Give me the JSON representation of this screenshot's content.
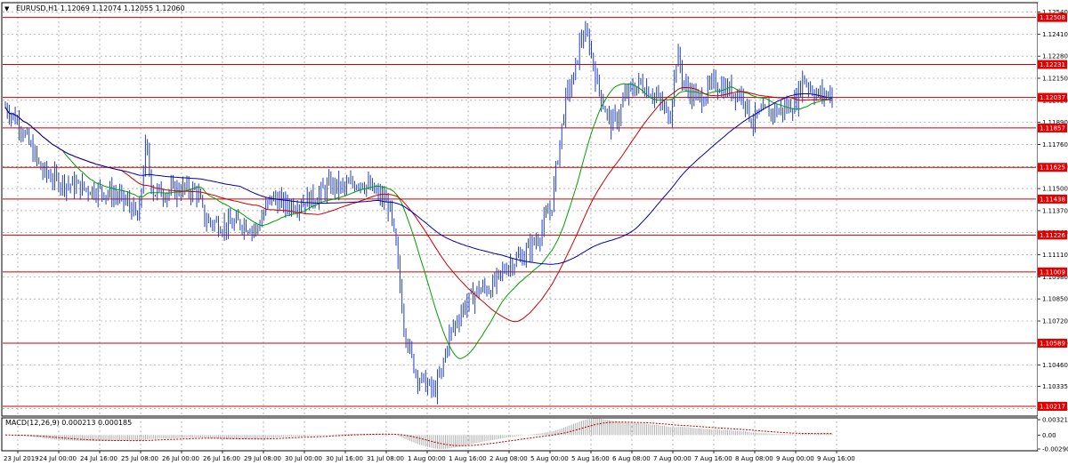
{
  "chart_data": {
    "type": "candlestick",
    "symbol_header": "EURUSD,H1  1.12069 1.12074 1.12055 1.12060",
    "y_ticks": [
      "1.12540",
      "1.12410",
      "1.12280",
      "1.12150",
      "1.12020",
      "1.11890",
      "1.11760",
      "1.11630",
      "1.11500",
      "1.11370",
      "1.11240",
      "1.11110",
      "1.10980",
      "1.10850",
      "1.10720",
      "1.10590",
      "1.10460",
      "1.10335",
      "1.10205"
    ],
    "x_ticks": [
      "23 Jul 2019",
      "24 Jul 00:00",
      "24 Jul 16:00",
      "25 Jul 08:00",
      "26 Jul 00:00",
      "26 Jul 16:00",
      "29 Jul 08:00",
      "30 Jul 00:00",
      "30 Jul 16:00",
      "31 Jul 08:00",
      "1 Aug 00:00",
      "1 Aug 16:00",
      "2 Aug 08:00",
      "5 Aug 00:00",
      "5 Aug 16:00",
      "6 Aug 08:00",
      "7 Aug 00:00",
      "7 Aug 16:00",
      "8 Aug 08:00",
      "9 Aug 00:00",
      "9 Aug 16:00"
    ],
    "ylim": [
      1.1017,
      1.1259
    ],
    "grid": true,
    "levels": [
      {
        "label": "1.12508",
        "value": 1.12508
      },
      {
        "label": "1.12231",
        "value": 1.12231
      },
      {
        "label": "1.11857",
        "value": 1.11857
      },
      {
        "label": "1.11625",
        "value": 1.11625
      },
      {
        "label": "1.11438",
        "value": 1.11438
      },
      {
        "label": "1.11226",
        "value": 1.11226
      },
      {
        "label": "1.11009",
        "value": 1.11009
      },
      {
        "label": "1.10589",
        "value": 1.10589
      },
      {
        "label": "1.10217",
        "value": 1.10217
      }
    ],
    "current_price": {
      "label": "1.12037",
      "value": 1.12037
    },
    "price_path": [
      [
        0,
        1.1198
      ],
      [
        2,
        1.1188
      ],
      [
        3,
        1.1178
      ],
      [
        5,
        1.116
      ],
      [
        7,
        1.1155
      ],
      [
        9,
        1.1152
      ],
      [
        11,
        1.115
      ],
      [
        13,
        1.1149
      ],
      [
        15,
        1.1146
      ],
      [
        17,
        1.114
      ],
      [
        18,
        1.113
      ],
      [
        19,
        1.1175
      ],
      [
        20,
        1.1148
      ],
      [
        22,
        1.1148
      ],
      [
        24,
        1.115
      ],
      [
        26,
        1.1148
      ],
      [
        27,
        1.1132
      ],
      [
        28,
        1.113
      ],
      [
        30,
        1.1128
      ],
      [
        32,
        1.113
      ],
      [
        34,
        1.1126
      ],
      [
        35,
        1.1135
      ],
      [
        36,
        1.1145
      ],
      [
        38,
        1.114
      ],
      [
        40,
        1.1142
      ],
      [
        42,
        1.1145
      ],
      [
        44,
        1.1152
      ],
      [
        46,
        1.115
      ],
      [
        48,
        1.1155
      ],
      [
        50,
        1.1148
      ],
      [
        52,
        1.114
      ],
      [
        53,
        1.1112
      ],
      [
        54,
        1.107
      ],
      [
        55,
        1.105
      ],
      [
        56,
        1.1038
      ],
      [
        57,
        1.1035
      ],
      [
        58,
        1.103
      ],
      [
        59,
        1.104
      ],
      [
        60,
        1.1062
      ],
      [
        62,
        1.108
      ],
      [
        64,
        1.109
      ],
      [
        66,
        1.1092
      ],
      [
        68,
        1.1105
      ],
      [
        70,
        1.111
      ],
      [
        72,
        1.112
      ],
      [
        74,
        1.114
      ],
      [
        75,
        1.1175
      ],
      [
        76,
        1.1205
      ],
      [
        77,
        1.1215
      ],
      [
        78,
        1.124
      ],
      [
        79,
        1.1238
      ],
      [
        80,
        1.1215
      ],
      [
        81,
        1.12
      ],
      [
        82,
        1.1188
      ],
      [
        83,
        1.1192
      ],
      [
        84,
        1.1205
      ],
      [
        86,
        1.1212
      ],
      [
        88,
        1.1205
      ],
      [
        90,
        1.1192
      ],
      [
        91,
        1.123
      ],
      [
        92,
        1.121
      ],
      [
        94,
        1.1202
      ],
      [
        96,
        1.1212
      ],
      [
        98,
        1.1208
      ],
      [
        100,
        1.1205
      ],
      [
        101,
        1.119
      ],
      [
        103,
        1.1195
      ],
      [
        105,
        1.1196
      ],
      [
        107,
        1.12
      ],
      [
        108,
        1.1215
      ],
      [
        110,
        1.1205
      ],
      [
        112,
        1.1206
      ]
    ],
    "moving_averages": [
      {
        "color": "#00a000",
        "period": 10
      },
      {
        "color": "#cc0000",
        "period": 20
      },
      {
        "color": "#0000aa",
        "period": 40
      }
    ],
    "candle_color": "#1f3fbf",
    "macd": {
      "header": "MACD(12,26,9) 0.000213 0.000185",
      "y_ticks": [
        "0.00321",
        "0.00",
        "-0.002908"
      ],
      "ylim": [
        -0.002908,
        0.00321
      ],
      "hist_color": "#b0b0b0",
      "signal_color": "#c00000"
    },
    "right_arrow": "▼"
  }
}
